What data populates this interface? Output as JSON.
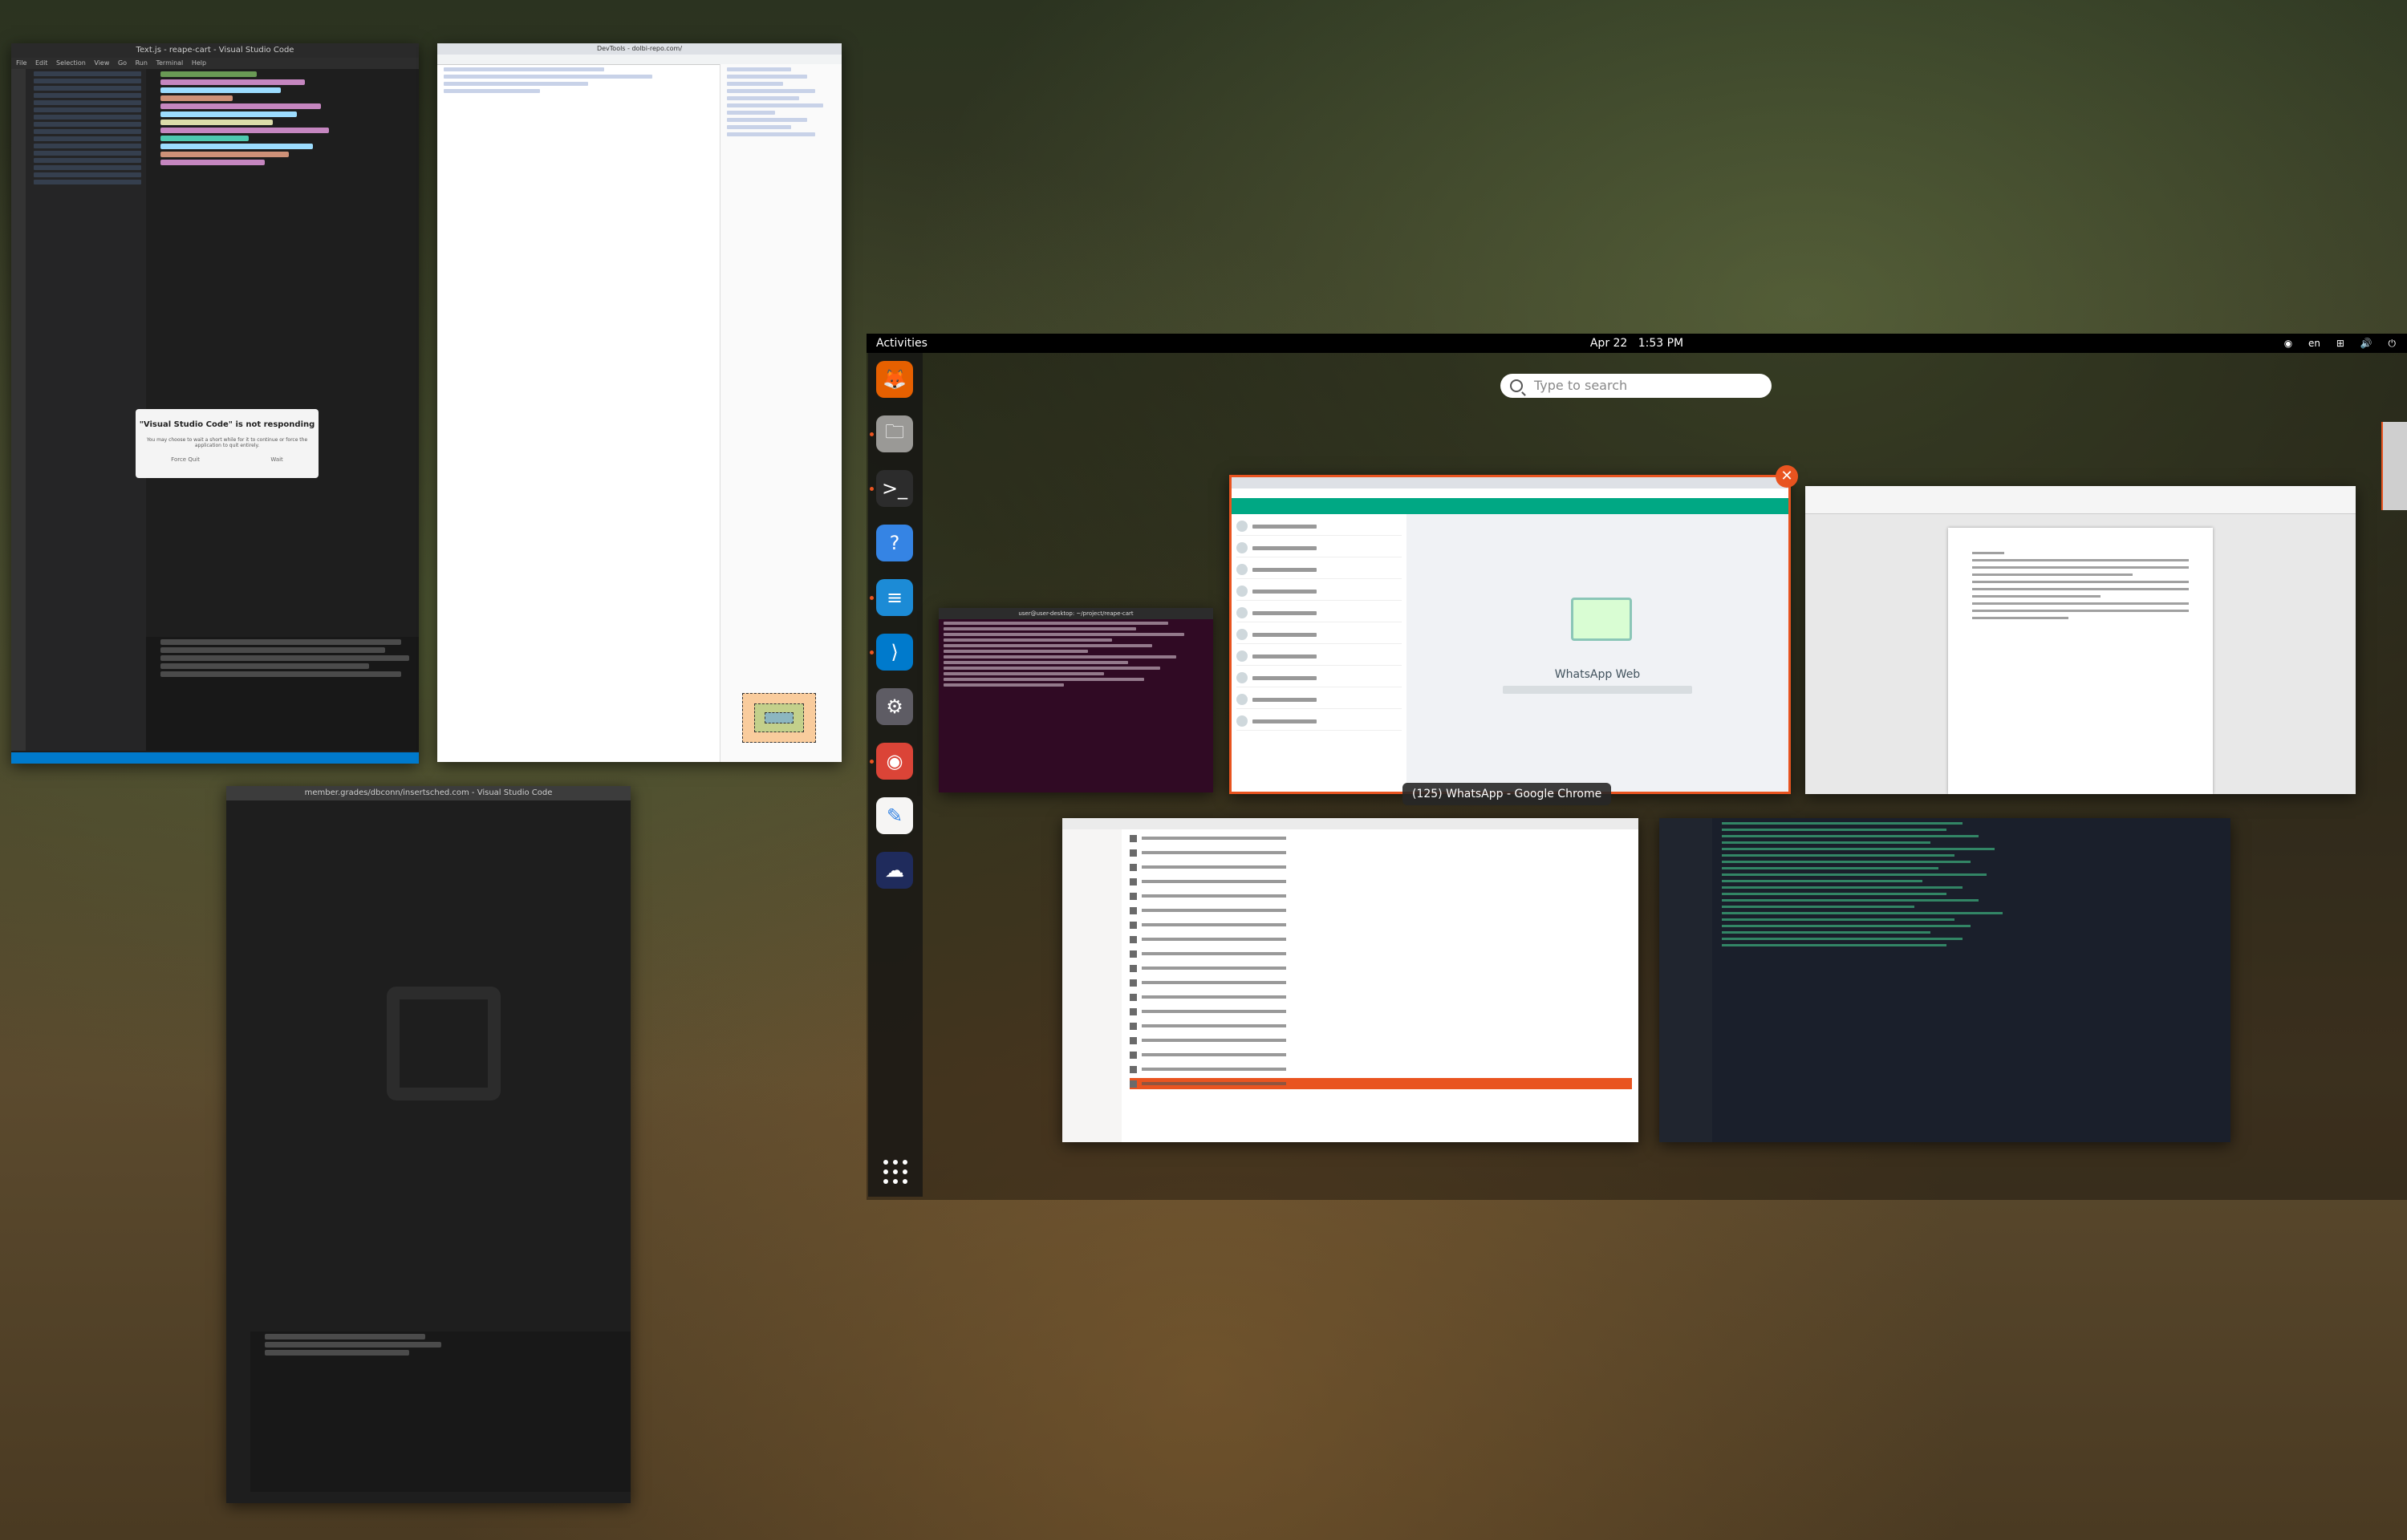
{
  "topbar": {
    "activities": "Activities",
    "date": "Apr 22",
    "time": "1:53 PM",
    "lang": "en"
  },
  "search": {
    "placeholder": "Type to search"
  },
  "dock": {
    "items": [
      {
        "name": "firefox-icon",
        "glyph": "🦊",
        "color": "#e66000",
        "running": false
      },
      {
        "name": "files-icon",
        "glyph": "🗀",
        "color": "#9a9996",
        "running": true
      },
      {
        "name": "terminal-icon",
        "glyph": ">_",
        "color": "#2c2c2c",
        "running": true
      },
      {
        "name": "help-icon",
        "glyph": "?",
        "color": "#3584e4",
        "running": false
      },
      {
        "name": "writer-icon",
        "glyph": "≡",
        "color": "#1c8bd6",
        "running": true
      },
      {
        "name": "vscode-icon",
        "glyph": "⟩",
        "color": "#007acc",
        "running": true
      },
      {
        "name": "settings-icon",
        "glyph": "⚙",
        "color": "#5e5c64",
        "running": false
      },
      {
        "name": "chrome-icon",
        "glyph": "◉",
        "color": "#db4437",
        "running": true
      },
      {
        "name": "text-editor-icon",
        "glyph": "✎",
        "color": "#f6f5f4",
        "running": false
      },
      {
        "name": "cloud-app-icon",
        "glyph": "☁",
        "color": "#1f2b5c",
        "running": false
      }
    ]
  },
  "windows": {
    "vscode_left": {
      "title": "Text.js - reape-cart - Visual Studio Code",
      "menu": [
        "File",
        "Edit",
        "Selection",
        "View",
        "Go",
        "Run",
        "Terminal",
        "Help"
      ]
    },
    "dialog": {
      "title": "\"Visual Studio Code\" is not responding",
      "message": "You may choose to wait a short while for it to continue or force the application to quit entirely.",
      "wait": "Wait",
      "quit": "Force Quit"
    },
    "devtools": {
      "title": "DevTools - dolbi-repo.com/"
    },
    "vscode_bottom": {
      "title": "member.grades/dbconn/insertsched.com - Visual Studio Code"
    },
    "terminal": {
      "title": "user@user-desktop: ~/project/reape-cart"
    },
    "chrome": {
      "label": "(125) WhatsApp - Google Chrome",
      "wa_title": "WhatsApp Web"
    }
  },
  "colors": {
    "accent": "#e95420",
    "topbar": "#000000",
    "whatsapp": "#00a884"
  }
}
